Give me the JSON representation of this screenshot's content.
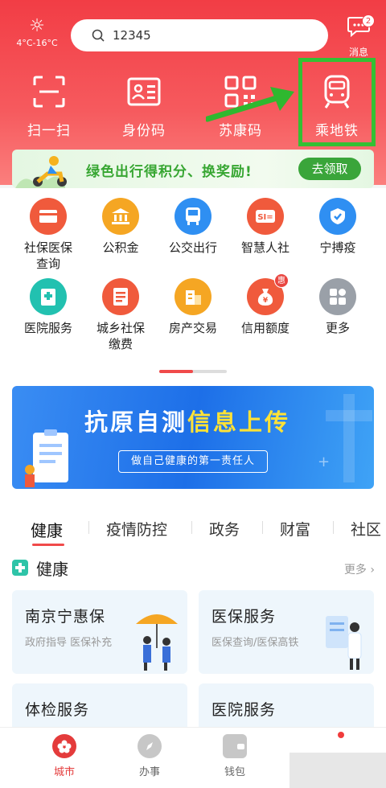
{
  "header": {
    "weather": {
      "icon": "sun-icon",
      "temp": "4°C-16°C"
    },
    "search": {
      "value": "12345",
      "icon": "search-icon"
    },
    "messages": {
      "label": "消息",
      "badge": "2",
      "icon": "chat-bubble-icon"
    }
  },
  "quick_actions": [
    {
      "label": "扫一扫",
      "icon": "scan-icon"
    },
    {
      "label": "身份码",
      "icon": "id-card-icon"
    },
    {
      "label": "苏康码",
      "icon": "qr-code-icon"
    },
    {
      "label": "乘地铁",
      "icon": "metro-icon"
    }
  ],
  "promo": {
    "text": "绿色出行得积分、换奖励!",
    "button": "去领取"
  },
  "services": [
    {
      "label": "社保医保\n查询",
      "color": "#f05a3c",
      "icon": "card-icon"
    },
    {
      "label": "公积金",
      "color": "#f5a623",
      "icon": "bank-icon"
    },
    {
      "label": "公交出行",
      "color": "#2f8ff2",
      "icon": "bus-icon"
    },
    {
      "label": "智慧人社",
      "color": "#f05a3c",
      "icon": "si-icon"
    },
    {
      "label": "宁搏疫",
      "color": "#2f8ff2",
      "icon": "shield-icon"
    },
    {
      "label": "医院服务",
      "color": "#22c1b0",
      "icon": "hospital-icon"
    },
    {
      "label": "城乡社保\n缴费",
      "color": "#f05a3c",
      "icon": "document-icon"
    },
    {
      "label": "房产交易",
      "color": "#f5a623",
      "icon": "building-icon"
    },
    {
      "label": "信用额度",
      "color": "#f05a3c",
      "icon": "money-bag-icon",
      "tag": "惠"
    },
    {
      "label": "更多",
      "color": "#9aa0a8",
      "icon": "grid-more-icon"
    }
  ],
  "test_banner": {
    "title_white": "抗原自测",
    "title_yellow": "信息上传",
    "subtitle": "做自己健康的第一责任人"
  },
  "tabs": [
    "健康",
    "疫情防控",
    "政务",
    "财富",
    "社区"
  ],
  "section": {
    "title": "健康",
    "more": "更多",
    "cards": [
      {
        "title": "南京宁惠保",
        "subtitle": "政府指导 医保补充"
      },
      {
        "title": "医保服务",
        "subtitle": "医保查询/医保高铁"
      },
      {
        "title": "体检服务",
        "subtitle": ""
      },
      {
        "title": "医院服务",
        "subtitle": ""
      }
    ]
  },
  "nav": [
    {
      "label": "城市",
      "icon": "city-icon",
      "active": true
    },
    {
      "label": "办事",
      "icon": "compass-icon"
    },
    {
      "label": "钱包",
      "icon": "wallet-icon"
    }
  ]
}
